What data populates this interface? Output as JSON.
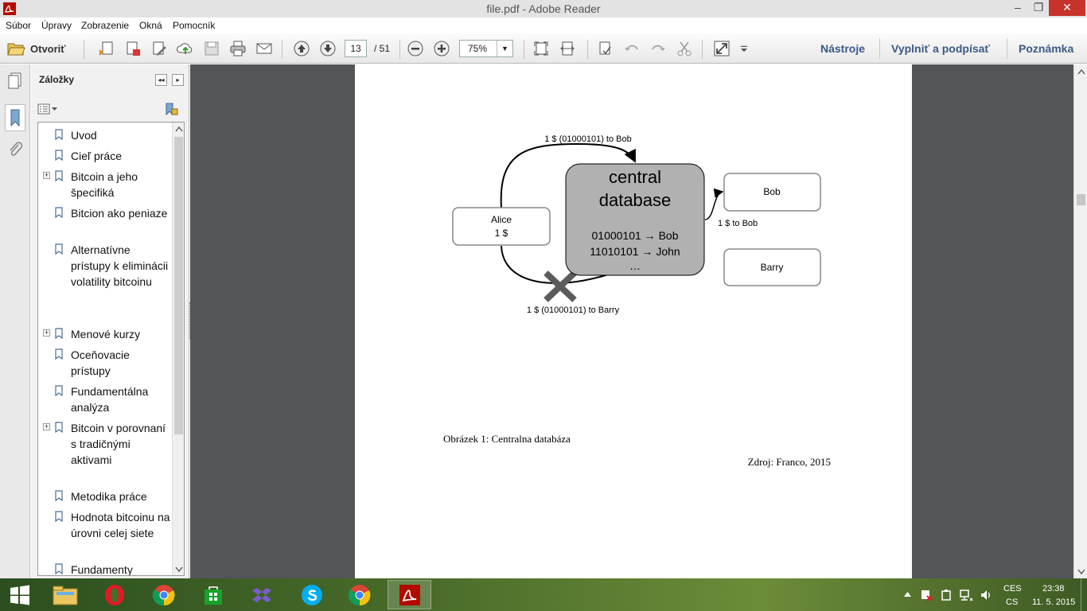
{
  "window": {
    "title": "file.pdf - Adobe Reader",
    "min_glyph": "–",
    "max_glyph": "❐",
    "close_glyph": "✕"
  },
  "menu": [
    "Súbor",
    "Úpravy",
    "Zobrazenie",
    "Okná",
    "Pomocník"
  ],
  "toolbar": {
    "open_label": "Otvoriť",
    "page_current": "13",
    "page_total": "/ 51",
    "zoom": "75%",
    "tools_label": "Nástroje",
    "sign_label": "Vyplniť a podpísať",
    "comment_label": "Poznámka"
  },
  "panel": {
    "title": "Záložky",
    "collapse_glyph": "◂◂",
    "expand_glyph": "▸",
    "bookmarks": [
      {
        "label": "Uvod",
        "expandable": false
      },
      {
        "label": "Cieľ práce",
        "expandable": false
      },
      {
        "label": "Bitcoin a jeho špecifiká",
        "expandable": true
      },
      {
        "label": "Bitcion ako peniaze",
        "expandable": false
      },
      {
        "label": "Alternatívne prístupy k eliminácii volatility bitcoinu",
        "expandable": false
      },
      {
        "label": "Menové kurzy",
        "expandable": true
      },
      {
        "label": "Oceňovacie prístupy",
        "expandable": false
      },
      {
        "label": "Fundamentálna analýza",
        "expandable": false
      },
      {
        "label": "Bitcoin v porovnaní s tradičnými aktivami",
        "expandable": true
      },
      {
        "label": "Metodika práce",
        "expandable": false
      },
      {
        "label": "Hodnota bitcoinu na úrovni celej siete",
        "expandable": false
      },
      {
        "label": "Fundamenty determinujúce",
        "expandable": false
      }
    ]
  },
  "figure": {
    "top_arrow_label": "1 $ (01000101) to Bob",
    "bottom_arrow_label": "1 $ (01000101) to Barry",
    "alice_name": "Alice",
    "alice_amount": "1 $",
    "db_title_line1": "central",
    "db_title_line2": "database",
    "db_entry1": "01000101 → Bob",
    "db_entry2": "11010101 → John",
    "db_more": "…",
    "bob_label": "Bob",
    "barry_label": "Barry",
    "bob_arrow_label": "1 $ to Bob",
    "caption": "Obrázek 1: Centralna databáza",
    "source": "Zdroj:  Franco, 2015"
  },
  "tray": {
    "lang_top": "CES",
    "lang_bottom": "CS",
    "time": "23:38",
    "date": "11. 5. 2015"
  },
  "colors": {
    "accent_link": "#3d5a86",
    "close_red": "#c7322a",
    "db_fill": "#b1b1b1",
    "viewer_bg": "#525659"
  }
}
